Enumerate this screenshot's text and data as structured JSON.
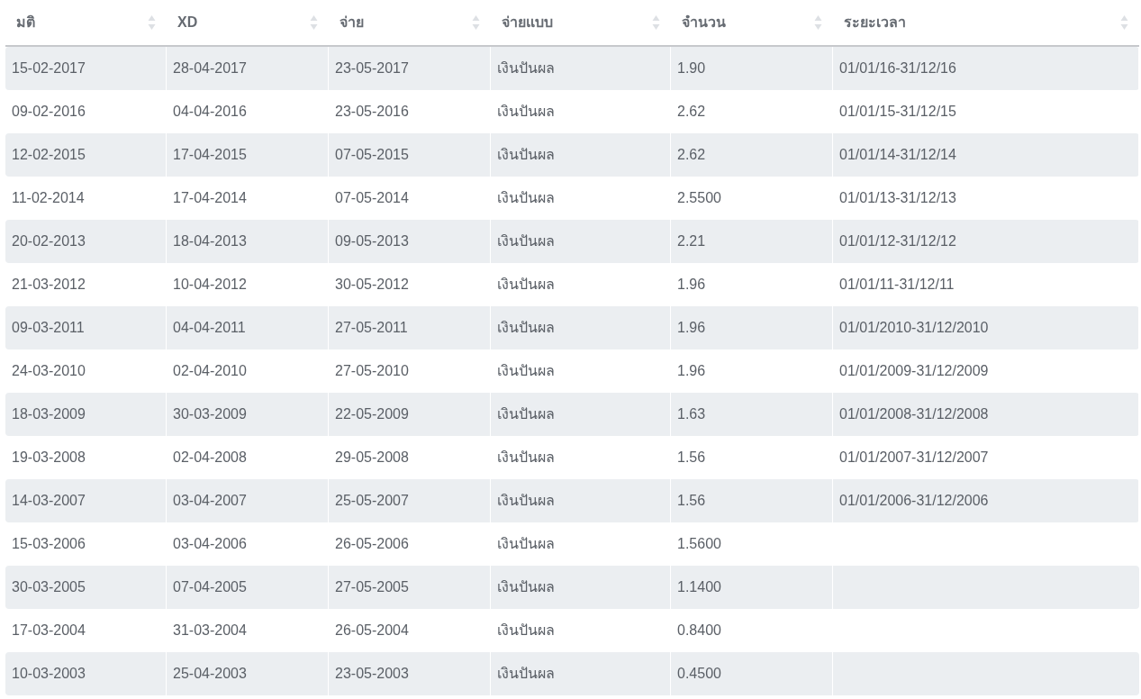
{
  "table": {
    "columns": [
      "มติ",
      "XD",
      "จ่าย",
      "จ่ายแบบ",
      "จำนวน",
      "ระยะเวลา"
    ],
    "rows": [
      [
        "15-02-2017",
        "28-04-2017",
        "23-05-2017",
        "เงินปันผล",
        "1.90",
        "01/01/16-31/12/16"
      ],
      [
        "09-02-2016",
        "04-04-2016",
        "23-05-2016",
        "เงินปันผล",
        "2.62",
        "01/01/15-31/12/15"
      ],
      [
        "12-02-2015",
        "17-04-2015",
        "07-05-2015",
        "เงินปันผล",
        "2.62",
        "01/01/14-31/12/14"
      ],
      [
        "11-02-2014",
        "17-04-2014",
        "07-05-2014",
        "เงินปันผล",
        "2.5500",
        "01/01/13-31/12/13"
      ],
      [
        "20-02-2013",
        "18-04-2013",
        "09-05-2013",
        "เงินปันผล",
        "2.21",
        "01/01/12-31/12/12"
      ],
      [
        "21-03-2012",
        "10-04-2012",
        "30-05-2012",
        "เงินปันผล",
        "1.96",
        "01/01/11-31/12/11"
      ],
      [
        "09-03-2011",
        "04-04-2011",
        "27-05-2011",
        "เงินปันผล",
        "1.96",
        "01/01/2010-31/12/2010"
      ],
      [
        "24-03-2010",
        "02-04-2010",
        "27-05-2010",
        "เงินปันผล",
        "1.96",
        "01/01/2009-31/12/2009"
      ],
      [
        "18-03-2009",
        "30-03-2009",
        "22-05-2009",
        "เงินปันผล",
        "1.63",
        "01/01/2008-31/12/2008"
      ],
      [
        "19-03-2008",
        "02-04-2008",
        "29-05-2008",
        "เงินปันผล",
        "1.56",
        "01/01/2007-31/12/2007"
      ],
      [
        "14-03-2007",
        "03-04-2007",
        "25-05-2007",
        "เงินปันผล",
        "1.56",
        "01/01/2006-31/12/2006"
      ],
      [
        "15-03-2006",
        "03-04-2006",
        "26-05-2006",
        "เงินปันผล",
        "1.5600"
      ],
      [
        "30-03-2005",
        "07-04-2005",
        "27-05-2005",
        "เงินปันผล",
        "1.1400"
      ],
      [
        "17-03-2004",
        "31-03-2004",
        "26-05-2004",
        "เงินปันผล",
        "0.8400"
      ],
      [
        "10-03-2003",
        "25-04-2003",
        "23-05-2003",
        "เงินปันผล",
        "0.4500"
      ]
    ]
  }
}
